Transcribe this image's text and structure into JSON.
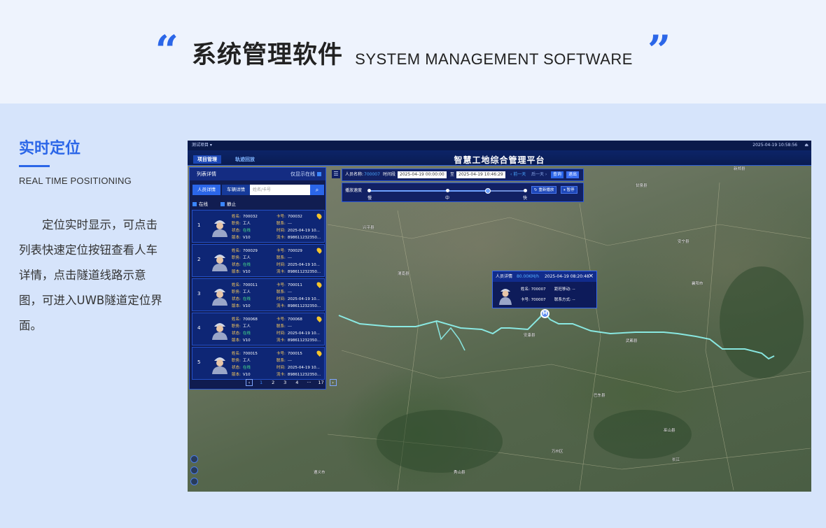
{
  "banner": {
    "quote_open": "“",
    "title_cn": "系统管理软件",
    "title_en": "SYSTEM MANAGEMENT SOFTWARE",
    "quote_close": "”"
  },
  "section": {
    "title": "实时定位",
    "subtitle": "REAL TIME POSITIONING",
    "description": "定位实时显示，可点击列表快速定位按钮查看人车详情，点击隧道线路示意图，可进入UWB隧道定位界面。"
  },
  "app": {
    "project_selector": "测试项目 ▾",
    "datetime": "2025-04-19 10:58:56",
    "platform_title": "智慧工地综合管理平台",
    "nav_tabs": [
      "项目管理",
      "轨迹回放"
    ],
    "colors": {
      "accent": "#2b66e8",
      "panel": "#0a1650",
      "online": "#49e58b",
      "label": "#ffcf5c",
      "track": "#7ff0f0"
    }
  },
  "list_panel": {
    "title": "列表详情",
    "only_online_label": "仅显示在线",
    "tabs": [
      "人员详情",
      "车辆详情"
    ],
    "search_placeholder": "姓名/卡号",
    "filters": [
      "在线",
      "静止"
    ],
    "field_labels": {
      "name": "姓名:",
      "job": "职务:",
      "status": "状态:",
      "version": "版本:",
      "card": "卡号:",
      "contact": "联系:",
      "time": "时间:",
      "sim": "流卡:"
    },
    "persons": [
      {
        "index": "1",
        "name": "700032",
        "job": "工人",
        "status": "在线",
        "version": "V10",
        "card": "700032",
        "contact": "---",
        "time": "2025-04-19 10...",
        "sim": "898611232350..."
      },
      {
        "index": "2",
        "name": "700029",
        "job": "工人",
        "status": "在线",
        "version": "V10",
        "card": "700029",
        "contact": "---",
        "time": "2025-04-19 10...",
        "sim": "898611232350..."
      },
      {
        "index": "3",
        "name": "700011",
        "job": "工人",
        "status": "在线",
        "version": "V10",
        "card": "700011",
        "contact": "---",
        "time": "2025-04-19 10...",
        "sim": "898611232350..."
      },
      {
        "index": "4",
        "name": "700068",
        "job": "工人",
        "status": "在线",
        "version": "V10",
        "card": "700068",
        "contact": "---",
        "time": "2025-04-19 10...",
        "sim": "898611232350..."
      },
      {
        "index": "5",
        "name": "700015",
        "job": "工人",
        "status": "在线",
        "version": "V10",
        "card": "700015",
        "contact": "---",
        "time": "2025-04-19 10...",
        "sim": "898611232350..."
      }
    ],
    "pagination": {
      "prev": "‹",
      "pages": [
        "1",
        "2",
        "3",
        "4",
        "···",
        "17"
      ],
      "next": "›",
      "current": "1"
    }
  },
  "query_bar": {
    "person_label": "人员名称:",
    "person_value": "700007",
    "time_range_label": "时间段",
    "start_time": "2025-04-19 00:00:00",
    "to_label": "至",
    "end_time": "2025-04-19 10:46:29",
    "prev_day": "‹ 前一天",
    "next_day": "后一天 ›",
    "query_button": "查询",
    "exit_button": "退出",
    "speed_label": "播放速度",
    "speed_ticks": [
      "慢",
      "中",
      "快"
    ],
    "speed_level": 0.75,
    "replay_button": "重新播放",
    "pause_button": "暂停"
  },
  "popup": {
    "title": "人员详情",
    "speed": "80.00KM/h",
    "timestamp": "2025-04-19 08:20:48",
    "name_label": "姓名:",
    "name": "700007",
    "card_label": "卡号:",
    "card": "700007",
    "mileage_label": "距旺移动:",
    "mileage": "--",
    "contact_label": "联系方式:",
    "contact": "--",
    "close": "×"
  },
  "marker_label": "M",
  "map_labels": [
    "新郑县",
    "甘泉县",
    "安宁县",
    "兴平县",
    "渭南县",
    "武都县",
    "安康县",
    "襄阳市",
    "巴东县",
    "巫山县",
    "万州区",
    "秀山县",
    "遵义市",
    "长江"
  ]
}
